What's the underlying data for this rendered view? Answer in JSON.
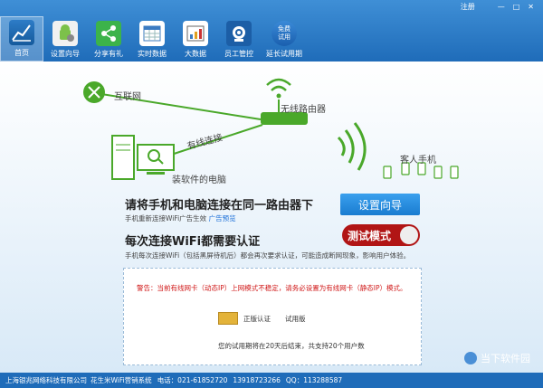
{
  "window": {
    "register": "注册",
    "controls": [
      "—",
      "□",
      "✕"
    ]
  },
  "toolbar": {
    "items": [
      {
        "label": "首页"
      },
      {
        "label": "设置向导"
      },
      {
        "label": "分享有礼"
      },
      {
        "label": "实时数据"
      },
      {
        "label": "大数据"
      },
      {
        "label": "员工管控"
      },
      {
        "label": "延长试用期",
        "icon_text_1": "免费",
        "icon_text_2": "试用"
      }
    ]
  },
  "diagram": {
    "internet": "互联网",
    "router": "无线路由器",
    "wired": "有线连接",
    "pc": "装软件的电脑",
    "phones": "客人手机"
  },
  "step1": {
    "title": "请将手机和电脑连接在同一路由器下",
    "desc": "手机重新连接WiFi广告生效",
    "link": "广告预览",
    "button": "设置向导"
  },
  "step2": {
    "title": "每次连接WiFi都需要认证",
    "desc": "手机每次连接WiFi（包括黑屏待机后）都会再次要求认证，可能造成断网现象，影响用户体验。",
    "button": "测试模式"
  },
  "panel": {
    "warning": "警告：当前有线网卡（动态IP）上网模式不稳定，请务必设置为有线网卡（静态IP）模式。",
    "activate": "正版认证",
    "trial": "试用版",
    "expiry": "您的试用期将在20天后结束，共支持20个用户数"
  },
  "status": {
    "company": "上海银兆网络科技有限公司",
    "product": "花生米WiFi营销系统",
    "phone": "电话：021-61852720",
    "mobile": "13918723266",
    "qq": "QQ：113288587"
  },
  "watermark": {
    "text": "当下软件园"
  },
  "colors": {
    "brand_blue": "#1f6cb9",
    "green": "#4aa82a",
    "test_red": "#b11515",
    "warning_red": "#d01818",
    "link_blue": "#1a6ed8"
  }
}
